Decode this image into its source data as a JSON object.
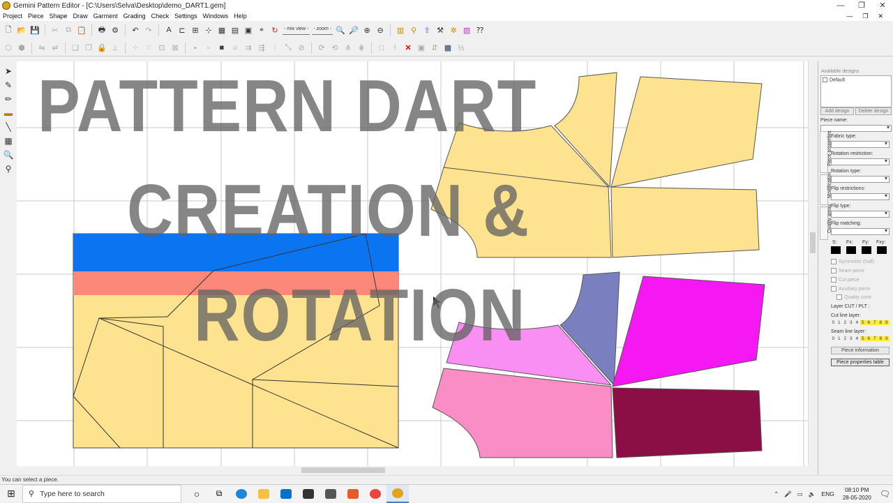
{
  "window": {
    "title": "Gemini Pattern Editor - [C:\\Users\\Selva\\Desktop\\demo_DART1.gem]",
    "controls": [
      "—",
      "❐",
      "✕"
    ]
  },
  "menu": {
    "items": [
      "Project",
      "Piece",
      "Shape",
      "Draw",
      "Garment",
      "Grading",
      "Check",
      "Settings",
      "Windows",
      "Help"
    ],
    "mdi_controls": [
      "—",
      "❐",
      "✕"
    ]
  },
  "toolbar": {
    "mix_view_label": "- mix view -",
    "zoom_label": "- zoom -"
  },
  "overlay": {
    "line1": "PATTERN DART",
    "line2": "CREATION &",
    "line3": "ROTATION"
  },
  "right_panel": {
    "available_designs": "Available designs",
    "designs": [
      "Default"
    ],
    "add_design": "Add design",
    "delete_design": "Delete design",
    "piece_name": "Piece name:",
    "fabric_type": "Fabric type:",
    "rotation_restriction": "Rotation restriction:",
    "rotation_type": "Rotation type:",
    "flip_restrictions": "Flip restrictions:",
    "flip_type": "Flip type:",
    "flip_matching": "Flip matching:",
    "tabs": [
      "Piece properties",
      "Modification",
      "Quality areas"
    ],
    "swatches": [
      "S:",
      "Fx:",
      "Fy:",
      "Fxy:"
    ],
    "checkboxes": [
      "Symmetric (half)",
      "Seam piece",
      "Cut piece",
      "Auxiliary piece",
      "Quality zone"
    ],
    "layer_title": "Layer CUT / PLT :",
    "cut_line_layer": "Cut line layer:",
    "seam_line_layer": "Seam line layer:",
    "layer_digits": [
      "0",
      "1",
      "2",
      "3",
      "4",
      "5",
      "6",
      "7",
      "8",
      "9"
    ],
    "piece_information": "Piece information",
    "piece_properties_table": "Piece properties table"
  },
  "status": {
    "text": "You can select a piece."
  },
  "taskbar": {
    "search_placeholder": "Type here to search",
    "lang": "ENG",
    "time": "08:10 PM",
    "date": "28-05-2020"
  },
  "colors": {
    "piece_yellow": "#fde38f",
    "blue_band": "#0b74f0",
    "salmon_band": "#fb8878",
    "lavender": "#7a7fbf",
    "magenta": "#f518f2",
    "light_pink": "#f98ff2",
    "rose": "#fa8dc6",
    "maroon": "#8b0f44"
  }
}
